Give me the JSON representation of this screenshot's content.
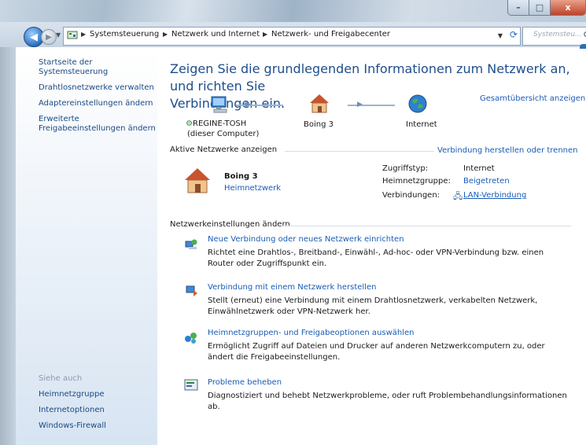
{
  "titlebar": {
    "min_label": "–",
    "max_label": "□",
    "close_label": "x"
  },
  "address": {
    "back_glyph": "◀",
    "forward_glyph": "▶",
    "crumbs": [
      "Systemsteuerung",
      "Netzwerk und Internet",
      "Netzwerk- und Freigabecenter"
    ],
    "search_placeholder": "Systemsteu..."
  },
  "sidebar": {
    "links": [
      "Startseite der Systemsteuerung",
      "Drahtlosnetzwerke verwalten",
      "Adaptereinstellungen ändern",
      "Erweiterte",
      "Freigabeeinstellungen ändern"
    ],
    "see_also": "Siehe auch",
    "see_also_links": [
      "Heimnetzgruppe",
      "Internetoptionen",
      "Windows-Firewall"
    ]
  },
  "main": {
    "title_line1": "Zeigen Sie die grundlegenden Informationen zum Netzwerk an, und richten Sie",
    "title_line2": "Verbindungen ein.",
    "map_link": "Gesamtübersicht anzeigen",
    "nodes": [
      {
        "label": "REGINE-TOSH",
        "sublabel": "(dieser Computer)"
      },
      {
        "label": "Boing 3"
      },
      {
        "label": "Internet"
      }
    ],
    "active_header": "Aktive Netzwerke anzeigen",
    "active_link": "Verbindung herstellen oder trennen",
    "network_name": "Boing 3",
    "network_type": "Heimnetzwerk",
    "access_type_label": "Zugriffstyp:",
    "access_type_value": "Internet",
    "homegroup_label": "Heimnetzgruppe:",
    "homegroup_value": "Beigetreten",
    "connections_label": "Verbindungen:",
    "connections_value": "LAN-Verbindung",
    "settings_header": "Netzwerkeinstellungen ändern",
    "tasks": [
      {
        "title": "Neue Verbindung oder neues Netzwerk einrichten",
        "desc": "Richtet eine Drahtlos-, Breitband-, Einwähl-, Ad-hoc- oder VPN-Verbindung bzw. einen Router oder Zugriffspunkt ein."
      },
      {
        "title": "Verbindung mit einem Netzwerk herstellen",
        "desc": "Stellt (erneut) eine Verbindung mit einem Drahtlosnetzwerk, verkabelten Netzwerk, Einwählnetzwerk oder VPN-Netzwerk her."
      },
      {
        "title": "Heimnetzgruppen- und Freigabeoptionen auswählen",
        "desc": "Ermöglicht Zugriff auf Dateien und Drucker auf anderen Netzwerkcomputern zu, oder ändert die Freigabeeinstellungen."
      },
      {
        "title": "Probleme beheben",
        "desc": "Diagnostiziert und behebt Netzwerkprobleme, oder ruft Problembehandlungsinformationen ab."
      }
    ]
  }
}
